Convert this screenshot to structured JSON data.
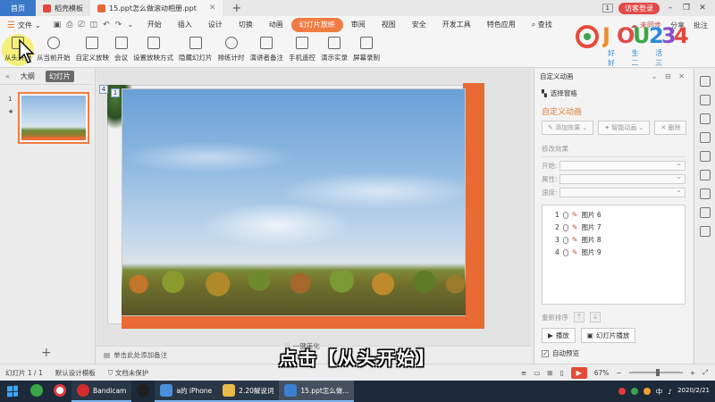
{
  "titlebar": {
    "home_tab": "首页",
    "tabs": [
      {
        "label": "稻壳模板",
        "color": "#e2483c",
        "active": false
      },
      {
        "label": "15.ppt怎么做滚动相册.ppt",
        "color": "#e6683a",
        "active": true
      }
    ],
    "new_tab": "+",
    "page_count": "1",
    "login_label": "访客登录"
  },
  "menubar": {
    "file_label": "文件",
    "items": [
      {
        "label": "开始",
        "active": false
      },
      {
        "label": "插入",
        "active": false
      },
      {
        "label": "设计",
        "active": false
      },
      {
        "label": "切换",
        "active": false
      },
      {
        "label": "动画",
        "active": false
      },
      {
        "label": "幻灯片放映",
        "active": true
      },
      {
        "label": "审阅",
        "active": false
      },
      {
        "label": "视图",
        "active": false
      },
      {
        "label": "安全",
        "active": false
      },
      {
        "label": "开发工具",
        "active": false
      },
      {
        "label": "特色应用",
        "active": false
      },
      {
        "label": "查找",
        "active": false
      }
    ],
    "right": {
      "sync": "未同步",
      "share": "分享",
      "comment": "批注"
    }
  },
  "ribbon": {
    "buttons": [
      {
        "label": "从头开始",
        "icon": "slide-start-icon"
      },
      {
        "label": "从当前开始",
        "icon": "slide-current-icon"
      },
      {
        "label": "自定义放映",
        "icon": "custom-show-icon"
      },
      {
        "label": "会议",
        "icon": "meeting-icon"
      },
      {
        "label": "设置放映方式",
        "icon": "setup-show-icon"
      },
      {
        "label": "隐藏幻灯片",
        "icon": "hide-slide-icon"
      },
      {
        "label": "排练计时",
        "icon": "timer-icon"
      },
      {
        "label": "演讲者备注",
        "icon": "speaker-notes-icon"
      },
      {
        "label": "手机遥控",
        "icon": "phone-remote-icon"
      },
      {
        "label": "演示实录",
        "icon": "record-icon"
      },
      {
        "label": "屏幕录制",
        "icon": "screen-record-icon"
      }
    ]
  },
  "logo": {
    "text": "JJOU234",
    "sub": "好 生 活 好 二 三 四"
  },
  "leftpanel": {
    "tabs": [
      "大纲",
      "幻灯片"
    ],
    "active_tab": "幻灯片",
    "slide_number": "1",
    "star": "★",
    "add": "+"
  },
  "canvas": {
    "badge_1": "1",
    "badge_4": "4",
    "notes_placeholder": "单击此处添加备注",
    "beautify": "一键美化"
  },
  "rightpanel": {
    "title": "自定义动画",
    "select_pane": "选择窗格",
    "heading": "自定义动画",
    "add_effect": "添加效果",
    "smart_anim": "智能动画",
    "delete": "删除",
    "modify_section": "修改效果",
    "start_label": "开始:",
    "property_label": "属性:",
    "speed_label": "速度:",
    "items": [
      {
        "index": "1",
        "name": "图片 6"
      },
      {
        "index": "2",
        "name": "图片 7"
      },
      {
        "index": "3",
        "name": "图片 8"
      },
      {
        "index": "4",
        "name": "图片 9"
      }
    ],
    "reorder_label": "重新排序",
    "play_label": "播放",
    "slideshow_label": "幻灯片播放",
    "autopreview_label": "自动预览",
    "autopreview_checked": true
  },
  "statusbar": {
    "slide_info": "幻灯片 1 / 1",
    "template": "默认设计模板",
    "protect": "文档未保护",
    "zoom": "67%"
  },
  "subtitle": "点击【从头开始】",
  "taskbar": {
    "apps": [
      {
        "label": "",
        "icon_color": "#3aa54a",
        "state": "normal"
      },
      {
        "label": "",
        "icon_color": "#e23b3b",
        "state": "normal"
      },
      {
        "label": "Bandicam",
        "icon_color": "#d42c2c",
        "state": "running"
      },
      {
        "label": "",
        "icon_color": "#1f1f1f",
        "state": "normal"
      },
      {
        "label": "a的 iPhone",
        "icon_color": "#4a90d9",
        "state": "running"
      },
      {
        "label": "2.20解说词",
        "icon_color": "#e8b84a",
        "state": "running"
      },
      {
        "label": "15.ppt怎么做...",
        "icon_color": "#3e7fcf",
        "state": "active"
      }
    ],
    "ime": "中",
    "date": "2020/2/21"
  }
}
